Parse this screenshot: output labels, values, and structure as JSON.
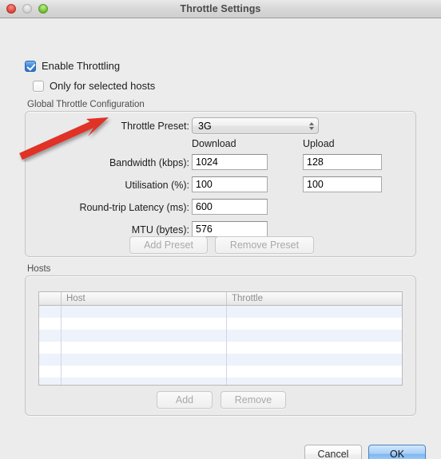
{
  "window": {
    "title": "Throttle Settings",
    "traffic_lights": [
      "close-button",
      "minimize-button",
      "zoom-button"
    ]
  },
  "checkboxes": {
    "enable_throttling": {
      "label": "Enable Throttling",
      "checked": true
    },
    "only_selected_hosts": {
      "label": "Only for selected hosts",
      "checked": false
    }
  },
  "global_group": {
    "label": "Global Throttle Configuration",
    "preset": {
      "label": "Throttle Preset:",
      "value": "3G"
    },
    "column_headers": {
      "download": "Download",
      "upload": "Upload"
    },
    "fields": [
      {
        "label": "Bandwidth (kbps):",
        "download": "1024",
        "upload": "128"
      },
      {
        "label": "Utilisation (%):",
        "download": "100",
        "upload": "100"
      },
      {
        "label": "Round-trip Latency (ms):",
        "download": "600",
        "upload": null
      },
      {
        "label": "MTU (bytes):",
        "download": "576",
        "upload": null
      }
    ],
    "buttons": {
      "add_preset": {
        "label": "Add Preset",
        "enabled": false
      },
      "remove_preset": {
        "label": "Remove Preset",
        "enabled": false
      }
    }
  },
  "hosts_group": {
    "label": "Hosts",
    "table": {
      "columns": [
        "",
        "Host",
        "Throttle"
      ],
      "rows": [],
      "visible_empty_rows": 7
    },
    "buttons": {
      "add": {
        "label": "Add",
        "enabled": false
      },
      "remove": {
        "label": "Remove",
        "enabled": false
      }
    }
  },
  "footer": {
    "cancel": "Cancel",
    "ok": "OK"
  },
  "annotation": {
    "type": "arrow",
    "color": "#e03127",
    "points_to": "Throttle Preset:"
  }
}
